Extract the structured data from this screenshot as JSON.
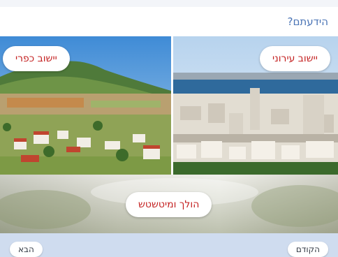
{
  "header": {
    "title": "הידעתם?"
  },
  "options": {
    "urban": "יישוב עירוני",
    "rural": "יישוב כפרי",
    "mixed": "הולך ומיטשטש"
  },
  "nav": {
    "previous": "הקודם",
    "next": "הבא"
  }
}
